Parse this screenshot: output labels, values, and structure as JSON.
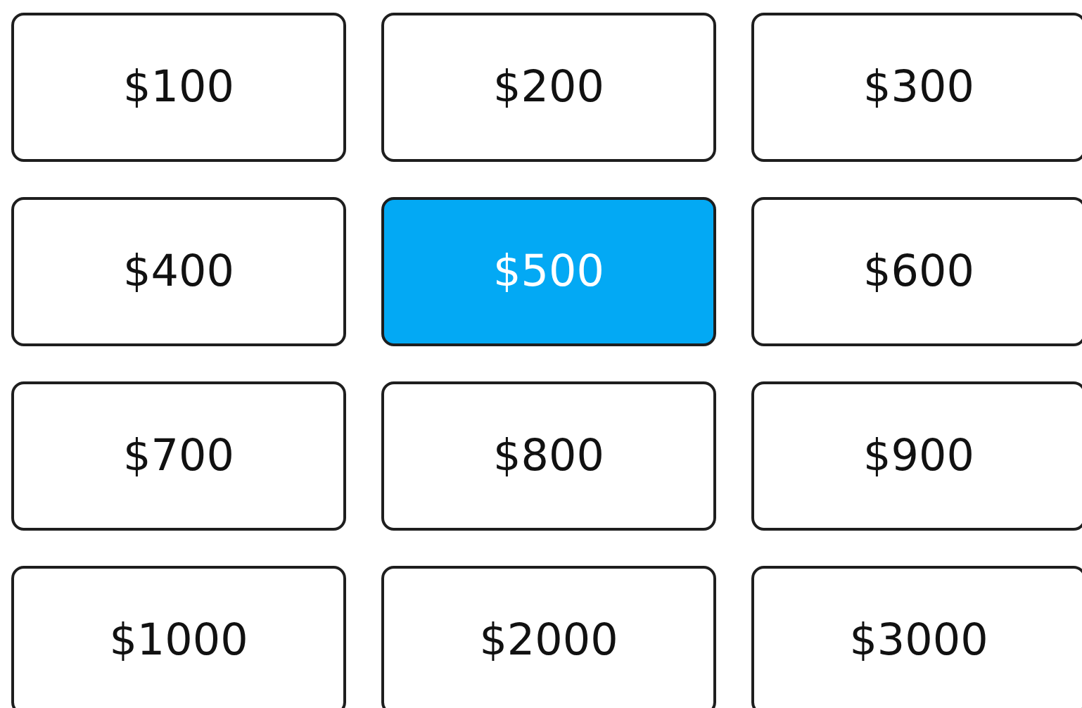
{
  "amounts": [
    {
      "label": "$100",
      "selected": false
    },
    {
      "label": "$200",
      "selected": false
    },
    {
      "label": "$300",
      "selected": false
    },
    {
      "label": "$400",
      "selected": false
    },
    {
      "label": "$500",
      "selected": true
    },
    {
      "label": "$600",
      "selected": false
    },
    {
      "label": "$700",
      "selected": false
    },
    {
      "label": "$800",
      "selected": false
    },
    {
      "label": "$900",
      "selected": false
    },
    {
      "label": "$1000",
      "selected": false
    },
    {
      "label": "$2000",
      "selected": false
    },
    {
      "label": "$3000",
      "selected": false
    }
  ]
}
